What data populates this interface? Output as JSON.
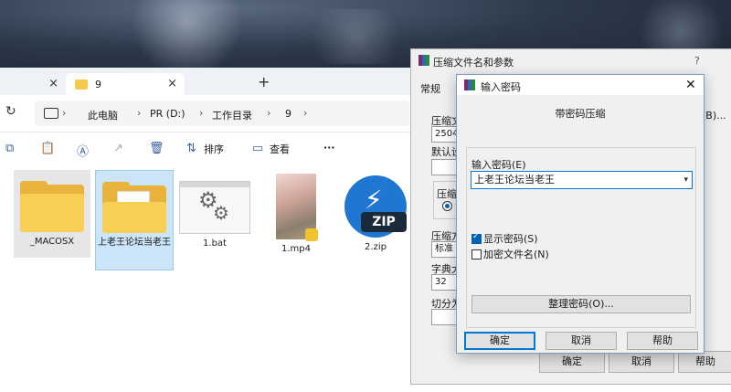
{
  "explorer": {
    "tabs": [
      {
        "label": "",
        "active": false
      },
      {
        "label": "9",
        "active": true
      }
    ],
    "new_tab": "+",
    "breadcrumbs": [
      "此电脑",
      "PR (D:)",
      "工作目录",
      "9"
    ],
    "toolbar": {
      "sort": "排序",
      "view": "查看",
      "more": "···"
    },
    "files": [
      {
        "name": "_MACOSX",
        "type": "folder"
      },
      {
        "name": "上老王论坛当老王",
        "type": "folder"
      },
      {
        "name": "1.bat",
        "type": "bat"
      },
      {
        "name": "1.mp4",
        "type": "video"
      },
      {
        "name": "2.zip",
        "type": "zip"
      }
    ],
    "zip_badge": "ZIP"
  },
  "rar": {
    "title": "压缩文件名和参数",
    "help": "?",
    "tab": "常规",
    "labels": {
      "archive_name": "压缩文",
      "archive_value": "25044",
      "default_setting": "默认设",
      "format": "压缩文",
      "method": "压缩方",
      "method_value": "标准",
      "dict": "字典大",
      "dict_value": "32",
      "split": "切分为",
      "right_browse": "(B)..."
    },
    "buttons": {
      "ok": "确定",
      "cancel": "取消",
      "help": "帮助"
    }
  },
  "pwd": {
    "title": "输入密码",
    "close": "✕",
    "heading": "带密码压缩",
    "password_label": "输入密码(E)",
    "password_value": "上老王论坛当老王",
    "show_password": "显示密码(S)",
    "encrypt_names": "加密文件名(N)",
    "manage": "整理密码(O)...",
    "ok": "确定",
    "cancel": "取消",
    "help": "帮助"
  },
  "colors": {
    "accent": "#0078d7",
    "folder": "#f7cf55",
    "zip": "#1f77d1",
    "selected": "#cce4f7"
  }
}
